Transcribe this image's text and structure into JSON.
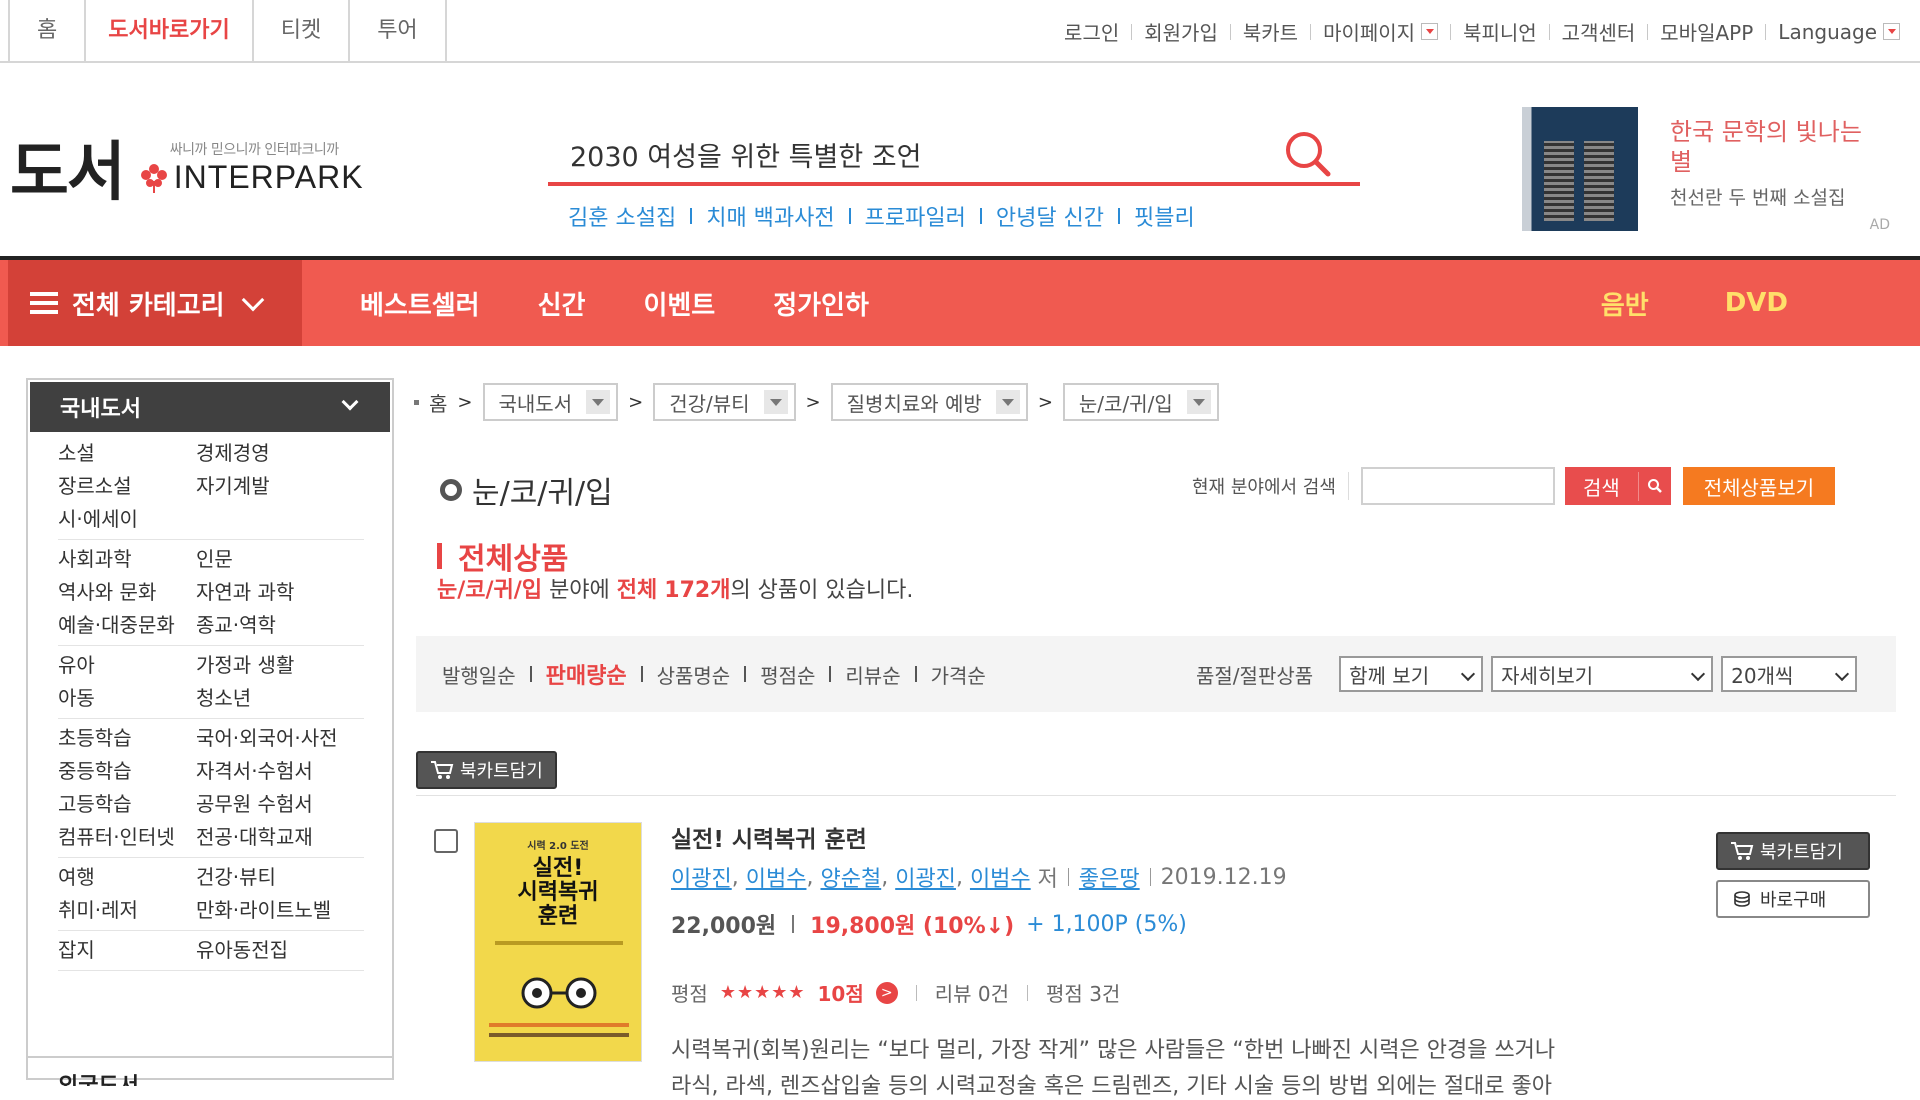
{
  "top_tabs": [
    {
      "label": "홈"
    },
    {
      "label": "도서바로가기",
      "active": true
    },
    {
      "label": "티켓"
    },
    {
      "label": "투어"
    }
  ],
  "top_links": [
    "로그인",
    "회원가입",
    "북카트",
    "마이페이지",
    "북피니언",
    "고객센터",
    "모바일APP",
    "Language"
  ],
  "logo": {
    "main": "도서",
    "tagline": "싸니까 믿으니까 인터파크니까",
    "brand": "INTERPARK"
  },
  "search": {
    "value": "2030 여성을 위한 특별한 조언"
  },
  "keywords": [
    "김훈 소설집",
    "치매 백과사전",
    "프로파일러",
    "안녕달 신간",
    "핏블리"
  ],
  "ad": {
    "title": "한국 문학의 빛나는 별",
    "desc": "천선란 두 번째 소설집",
    "mark": "AD"
  },
  "nav": {
    "category": "전체 카테고리",
    "items": [
      "베스트셀러",
      "신간",
      "이벤트",
      "정가인하"
    ],
    "right": [
      "음반",
      "DVD"
    ]
  },
  "sidebar": {
    "header": "국내도서",
    "groups": [
      [
        "소설",
        "경제경영",
        "장르소설",
        "자기계발",
        "시·에세이",
        ""
      ],
      [
        "사회과학",
        "인문",
        "역사와 문화",
        "자연과 과학",
        "예술·대중문화",
        "종교·역학"
      ],
      [
        "유아",
        "가정과 생활",
        "아동",
        "청소년"
      ],
      [
        "초등학습",
        "국어·외국어·사전",
        "중등학습",
        "자격서·수험서",
        "고등학습",
        "공무원 수험서",
        "컴퓨터·인터넷",
        "전공·대학교재"
      ],
      [
        "여행",
        "건강·뷰티",
        "취미·레저",
        "만화·라이트노벨"
      ],
      [
        "잡지",
        "유아동전집"
      ]
    ],
    "footer": "외국도서"
  },
  "breadcrumb": {
    "home": "홈",
    "levels": [
      "국내도서",
      "건강/뷰티",
      "질병치료와 예방",
      "눈/코/귀/입"
    ]
  },
  "page_title": "눈/코/귀/입",
  "field_search": {
    "label": "현재 분야에서 검색",
    "button": "검색",
    "all_button": "전체상품보기"
  },
  "section": {
    "title": "전체상품",
    "count_prefix": "눈/코/귀/입",
    "count_mid": " 분야에 ",
    "count_total_label": "전체",
    "count_value": "172개",
    "count_suffix": "의 상품이 있습니다."
  },
  "sorts": [
    {
      "label": "발행일순"
    },
    {
      "label": "판매량순",
      "active": true
    },
    {
      "label": "상품명순"
    },
    {
      "label": "평점순"
    },
    {
      "label": "리뷰순"
    },
    {
      "label": "가격순"
    }
  ],
  "filter": {
    "soldout_label": "품절/절판상품",
    "view_mode": "함께 보기",
    "detail": "자세히보기",
    "per_page": "20개씩"
  },
  "cart_button": "북카트담기",
  "product": {
    "title": "실전! 시력복귀 훈련",
    "authors": [
      "이광진",
      "이범수",
      "양순철",
      "이광진",
      "이범수"
    ],
    "author_suffix": "저",
    "publisher": "좋은땅",
    "date": "2019.12.19",
    "list_price": "22,000원",
    "sale_price": "19,800원 (10%↓)",
    "points": "+ 1,100P (5%)",
    "rating_label": "평점",
    "stars": "★★★★★",
    "score": "10점",
    "review": "리뷰 0건",
    "rating_count": "평점 3건",
    "desc_line1": "시력복귀(회복)원리는 “보다 멀리, 가장 작게” 많은 사람들은 “한번 나빠진 시력은 안경을 쓰거나",
    "desc_line2": "라식, 라섹, 렌즈삽입술 등의 시력교정술 혹은 드림렌즈, 기타 시술 등의 방법 외에는 절대로 좋아",
    "cover_top": "시력 2.0 도전",
    "cover_title_1": "실전!",
    "cover_title_2": "시력복귀",
    "cover_title_3": "훈련",
    "cart_label": "북카트담기",
    "buy_label": "바로구매"
  },
  "colors": {
    "accent": "#e84545",
    "nav": "#f05a50",
    "link": "#2a8bd6",
    "orange": "#f57a20"
  }
}
